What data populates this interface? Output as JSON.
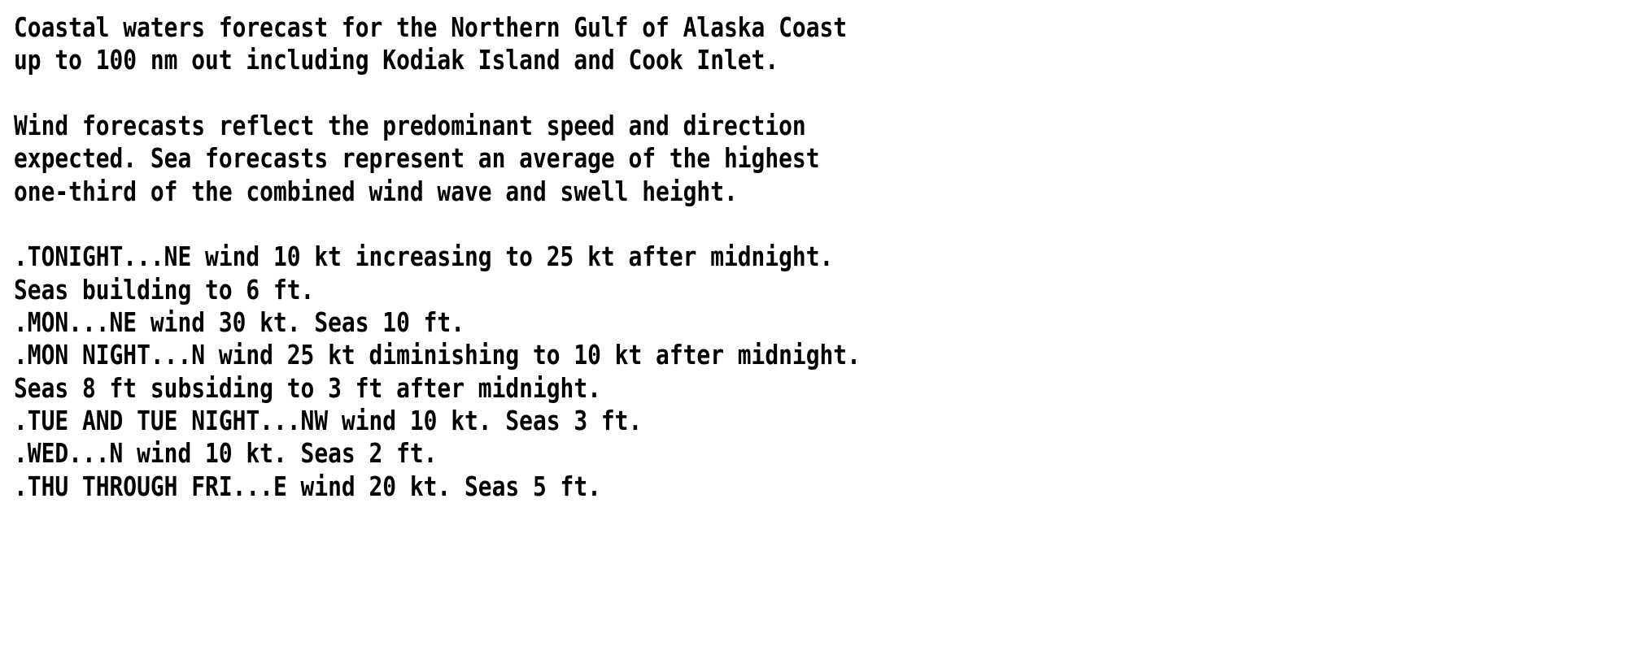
{
  "document": {
    "type": "plain-text-forecast",
    "background_color": "#ffffff",
    "text_color": "#000000",
    "header": {
      "lines": [
        "Coastal waters forecast for the Northern Gulf of Alaska Coast",
        "up to 100 nm out including Kodiak Island and Cook Inlet."
      ]
    },
    "disclaimer": {
      "lines": [
        "Wind forecasts reflect the predominant speed and direction",
        "expected. Sea forecasts represent an average of the highest",
        "one-third of the combined wind wave and swell height."
      ]
    },
    "forecast_periods": [
      {
        "label": ".TONIGHT...",
        "lines": [
          ".TONIGHT...NE wind 10 kt increasing to 25 kt after midnight.",
          "Seas building to 6 ft."
        ],
        "wind_direction": "NE",
        "wind_speed_kt": 10,
        "wind_speed_later_kt": 25,
        "seas_ft": 6
      },
      {
        "label": ".MON...",
        "lines": [
          ".MON...NE wind 30 kt. Seas 10 ft."
        ],
        "wind_direction": "NE",
        "wind_speed_kt": 30,
        "seas_ft": 10
      },
      {
        "label": ".MON NIGHT...",
        "lines": [
          ".MON NIGHT...N wind 25 kt diminishing to 10 kt after midnight.",
          "Seas 8 ft subsiding to 3 ft after midnight."
        ],
        "wind_direction": "N",
        "wind_speed_kt": 25,
        "wind_speed_later_kt": 10,
        "seas_ft": 8,
        "seas_later_ft": 3
      },
      {
        "label": ".TUE AND TUE NIGHT...",
        "lines": [
          ".TUE AND TUE NIGHT...NW wind 10 kt. Seas 3 ft."
        ],
        "wind_direction": "NW",
        "wind_speed_kt": 10,
        "seas_ft": 3
      },
      {
        "label": ".WED...",
        "lines": [
          ".WED...N wind 10 kt. Seas 2 ft."
        ],
        "wind_direction": "N",
        "wind_speed_kt": 10,
        "seas_ft": 2
      },
      {
        "label": ".THU THROUGH FRI...",
        "lines": [
          ".THU THROUGH FRI...E wind 20 kt. Seas 5 ft."
        ],
        "wind_direction": "E",
        "wind_speed_kt": 20,
        "seas_ft": 5
      }
    ],
    "rendered_lines": [
      "Coastal waters forecast for the Northern Gulf of Alaska Coast",
      "up to 100 nm out including Kodiak Island and Cook Inlet.",
      "",
      "Wind forecasts reflect the predominant speed and direction",
      "expected. Sea forecasts represent an average of the highest",
      "one-third of the combined wind wave and swell height.",
      "",
      ".TONIGHT...NE wind 10 kt increasing to 25 kt after midnight.",
      "Seas building to 6 ft.",
      ".MON...NE wind 30 kt. Seas 10 ft.",
      ".MON NIGHT...N wind 25 kt diminishing to 10 kt after midnight.",
      "Seas 8 ft subsiding to 3 ft after midnight.",
      ".TUE AND TUE NIGHT...NW wind 10 kt. Seas 3 ft.",
      ".WED...N wind 10 kt. Seas 2 ft.",
      ".THU THROUGH FRI...E wind 20 kt. Seas 5 ft."
    ]
  }
}
